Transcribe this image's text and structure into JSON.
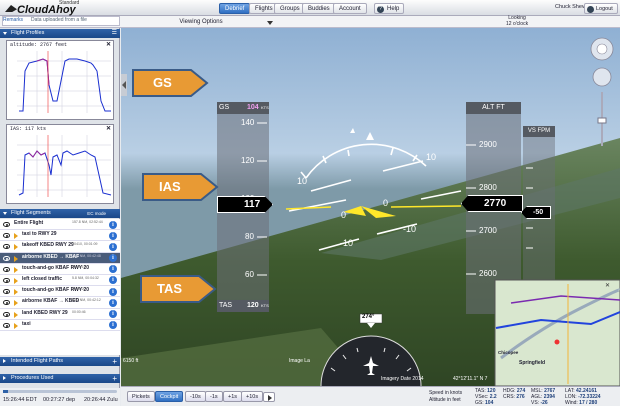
{
  "header": {
    "brand": "CloudAhoy",
    "edition": "Standard",
    "tabs": [
      "Debrief",
      "Flights",
      "Groups",
      "Buddies",
      "Account"
    ],
    "active_tab": "Debrief",
    "help": "Help",
    "user": "Chuck Shevit",
    "logout": "Logout"
  },
  "subbar": {
    "remarks_label": "Remarks",
    "remarks_text": "Data uploaded from a file",
    "view_options": "Viewing Options",
    "looking_line1": "Looking",
    "looking_line2": "12 o'clock"
  },
  "profiles": {
    "title": "Flight Profiles",
    "altitude_label": "altitude: 2767 feet",
    "ias_label": "IAS: 117 kts"
  },
  "segments": {
    "title": "Flight Segments",
    "mode": "EC mode",
    "items": [
      {
        "name": "Entire Flight",
        "meta": "157.8 NM, 02:52:44"
      },
      {
        "name": "taxi to RWY 29",
        "meta": ""
      },
      {
        "name": "takeoff KBED RWY 29",
        "meta": "T0410, 00:01:09"
      },
      {
        "name": "airborne KBED → KBAF",
        "meta": "78.5 NM, 00:42:48"
      },
      {
        "name": "touch-and-go KBAF RWY 20",
        "meta": "00:00:19"
      },
      {
        "name": "left closed traffic",
        "meta": "5.8 NM, 00:04:32"
      },
      {
        "name": "touch-and-go KBAF RWY 20",
        "meta": "00:00:20"
      },
      {
        "name": "airborne KBAF → KBED",
        "meta": "80.2 NM, 00:42:12"
      },
      {
        "name": "land KBED RWY 29",
        "meta": "00:00:46"
      },
      {
        "name": "taxi",
        "meta": ""
      }
    ]
  },
  "sections": {
    "intended": "Intended Flight Paths",
    "procedures": "Procedures Used"
  },
  "playback": {
    "time_edt": "15:26:44 EDT",
    "elapsed": "00:27:27 dep",
    "zulu": "20:26:44 Zulu",
    "progress": 0.04
  },
  "hud": {
    "gs_label": "GS",
    "gs_value": "104",
    "gs_unit": "KTS",
    "speed_ticks": [
      "140",
      "120",
      "100",
      "80",
      "60"
    ],
    "ias_value": "117",
    "tas_label": "TAS",
    "tas_value": "120",
    "tas_unit": "KTS",
    "alt_label": "ALT FT",
    "alt_ticks": [
      "2900",
      "2800",
      "2700",
      "2600"
    ],
    "alt_value": "2770",
    "vs_label": "VS FPM",
    "vs_value": "-50",
    "pitch_labels": [
      "10",
      "10",
      "-10",
      "-10"
    ],
    "pitch_zero": "0",
    "heading": "274°",
    "callouts": [
      "GS",
      "IAS",
      "TAS"
    ],
    "dist_label": "6150 ft",
    "image_credit": "Image La",
    "imagery_date": "Imagery Date 2014",
    "coords": "42°12'11.1\" N  7",
    "map_label1": "Chicopee",
    "map_label2": "Springfield"
  },
  "controls": {
    "pickets": "Pickets",
    "cockpit": "Cockpit",
    "steps": [
      "-10s",
      "-1s",
      "+1s",
      "+10s"
    ],
    "speed_note": "Speed in knots",
    "alt_note": "Altitude in feet"
  },
  "readouts": [
    {
      "k": "TAS:",
      "v": "120"
    },
    {
      "k": "HDG:",
      "v": "274"
    },
    {
      "k": "MSL:",
      "v": "2767"
    },
    {
      "k": "LAT:",
      "v": "42.24161"
    },
    {
      "k": "VSec:",
      "v": "2.2"
    },
    {
      "k": "CRS:",
      "v": "276"
    },
    {
      "k": "AGL:",
      "v": "2394"
    },
    {
      "k": "LON:",
      "v": "-72.33224"
    },
    {
      "k": "GS:",
      "v": "104"
    },
    {
      "k": "",
      "v": ""
    },
    {
      "k": "VS:",
      "v": "-26"
    },
    {
      "k": "Wind:",
      "v": "17 / 280"
    }
  ]
}
